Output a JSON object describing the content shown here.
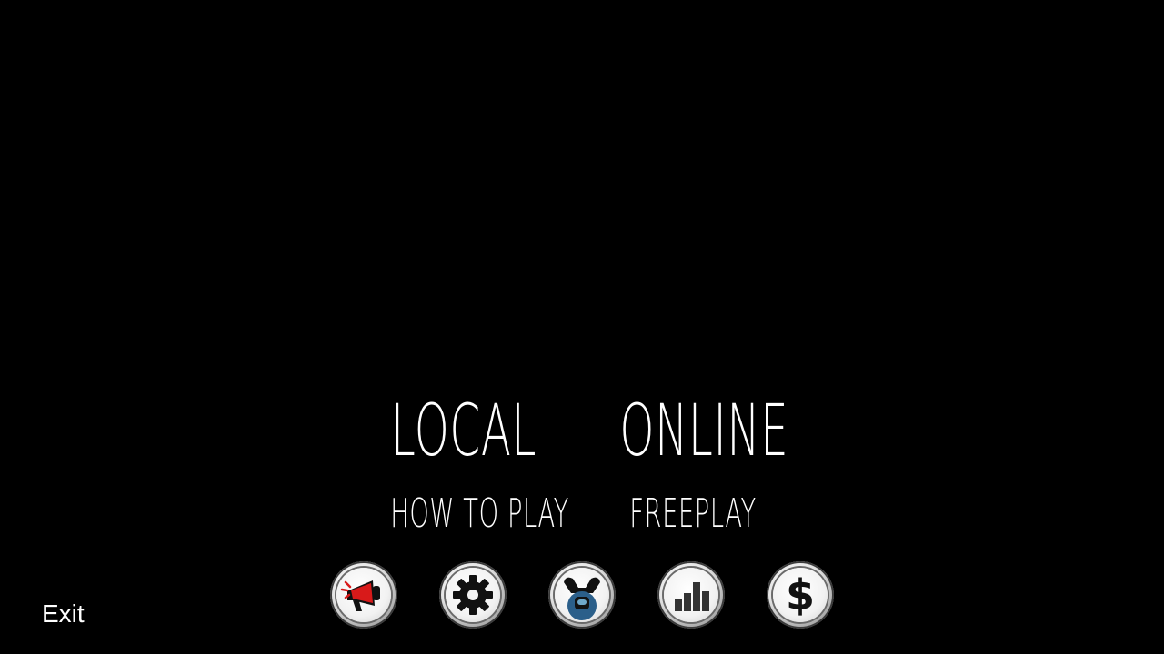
{
  "main_menu": {
    "local_label": "LOCAL",
    "online_label": "ONLINE",
    "how_to_play_label": "HOW TO PLAY",
    "freeplay_label": "FREEPLAY"
  },
  "icon_bar": [
    {
      "name": "announcement",
      "icon": "megaphone-icon"
    },
    {
      "name": "settings",
      "icon": "gear-icon"
    },
    {
      "name": "account",
      "icon": "crewmate-account-icon"
    },
    {
      "name": "stats",
      "icon": "bar-chart-icon"
    },
    {
      "name": "shop",
      "icon": "dollar-icon",
      "glyph": "$"
    }
  ],
  "exit_label": "Exit",
  "colors": {
    "background": "#000000",
    "text": "#ffffff",
    "accent_red": "#d81a1a",
    "icon_dark": "#111111"
  }
}
